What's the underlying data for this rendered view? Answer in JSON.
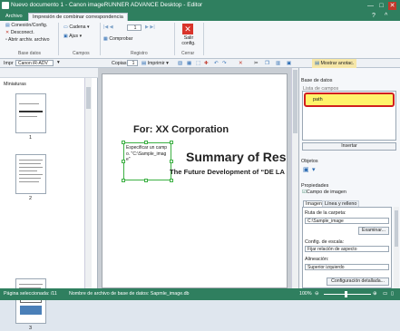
{
  "titlebar": {
    "title": "Nuevo documento 1 - Canon imageRUNNER ADVANCE Desktop - Editor",
    "minimize": "—",
    "maximize": "□",
    "close": "✕"
  },
  "tabs": {
    "file": "Archivo",
    "merge_print": "Impresión de combinar correspondencia"
  },
  "ribbon": {
    "database": {
      "connect": "Conexión/Config.",
      "disconnect": "Desconect.",
      "open_db_file": "Abrir archiv. archivo",
      "label": "Base datos"
    },
    "fields": {
      "text": "Cadena",
      "image": "Ajus",
      "label": "Campos"
    },
    "record": {
      "current": "1",
      "label": "Registro"
    },
    "check": "Comprobar",
    "close": {
      "btn": "Salir config.",
      "label": "Cerrar"
    }
  },
  "toolbar": {
    "print_label": "Impr",
    "printer": "Canon iR-ADV",
    "copies_label": "Copias",
    "copies_value": "1",
    "print_btn": "Imprimir",
    "show_notes": "Mostrar anotac."
  },
  "left_panel": {
    "title": "Miniaturas",
    "pages": [
      "1",
      "2",
      "3"
    ]
  },
  "document": {
    "corp": "For: XX Corporation",
    "field_box": "Especificar un campo. \"C:\\Sample_image\"",
    "summary": "Summary of Res",
    "subtitle": "The Future Development of “DE LA"
  },
  "right_panel": {
    "db_title": "Base de datos",
    "field_list_label": "Lista de campos",
    "field_item": "path",
    "insert": "Insertar",
    "objects": "Objetos",
    "properties": "Propiedades",
    "image_field": "Campo de imagen",
    "tab_image": "Imagen",
    "tab_line": "Línea y relleno",
    "folder_path_label": "Ruta de la carpeta:",
    "folder_path_value": "C:\\Sample_image",
    "browse": "Examinar...",
    "scale_label": "Config. de escala:",
    "scale_value": "Fijar relación de aspecto",
    "align_label": "Alineación:",
    "align_value": "Superior izquierdo",
    "detailed": "Configuración detallada..."
  },
  "status": {
    "selected": "Página seleccionada: /11",
    "db_name": "Nombre de archivo de base de datos: Sapmle_image.db",
    "zoom": "100%"
  }
}
